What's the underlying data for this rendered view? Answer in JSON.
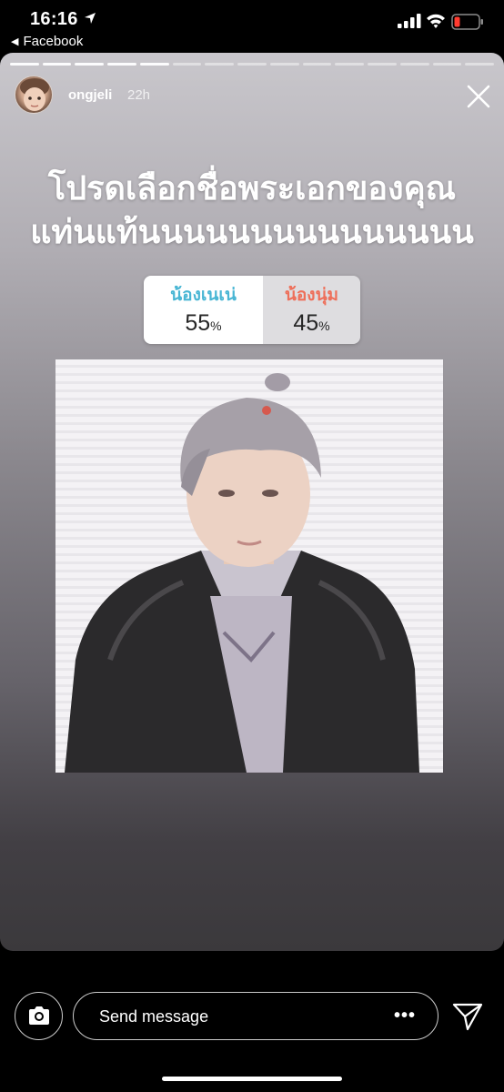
{
  "status_bar": {
    "time": "16:16",
    "back_app": "Facebook"
  },
  "story": {
    "progress_total": 15,
    "progress_done": 5,
    "username": "ongjeli",
    "age": "22h",
    "headline_line1": "โปรดเลือกชื่อพระเอกของคุณ",
    "headline_line2": "แท่นแท้นนนนนนนนนนนนนนน",
    "poll": {
      "options": [
        {
          "label": "น้องเนเน่",
          "percent": "55",
          "color": "#49b6d4"
        },
        {
          "label": "น้องนุ่ม",
          "percent": "45",
          "color": "#ee6f5a"
        }
      ],
      "percent_sign": "%"
    }
  },
  "bottom": {
    "placeholder": "Send message",
    "more": "•••"
  },
  "icons": [
    "location-arrow-icon",
    "signal-icon",
    "wifi-icon",
    "battery-icon",
    "close-icon",
    "camera-icon",
    "send-icon"
  ]
}
